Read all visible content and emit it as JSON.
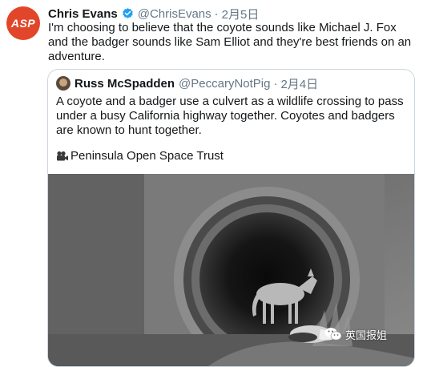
{
  "tweet": {
    "avatar_text": "ASP",
    "name": "Chris Evans",
    "handle": "@ChrisEvans",
    "separator": "·",
    "date": "2月5日",
    "text": "I'm choosing to believe that the coyote sounds like Michael J. Fox and the badger sounds like Sam Elliot and they're best friends on an adventure."
  },
  "quoted_tweet": {
    "name": "Russ McSpadden",
    "handle": "@PeccaryNotPig",
    "separator": "·",
    "date": "2月4日",
    "text": "A coyote and a badger use a culvert as a wildlife crossing to pass under a busy California highway together. Coyotes and badgers are known to hunt together.",
    "source": "Peninsula Open Space Trust"
  },
  "watermark": {
    "text": "英国报姐"
  },
  "colors": {
    "avatar_bg": "#e2462a",
    "verified_blue": "#1da1f2",
    "muted_text": "#657786",
    "border": "#ccd6dd"
  },
  "icons": [
    "verified-badge-icon",
    "video-camera-icon",
    "wechat-icon"
  ]
}
